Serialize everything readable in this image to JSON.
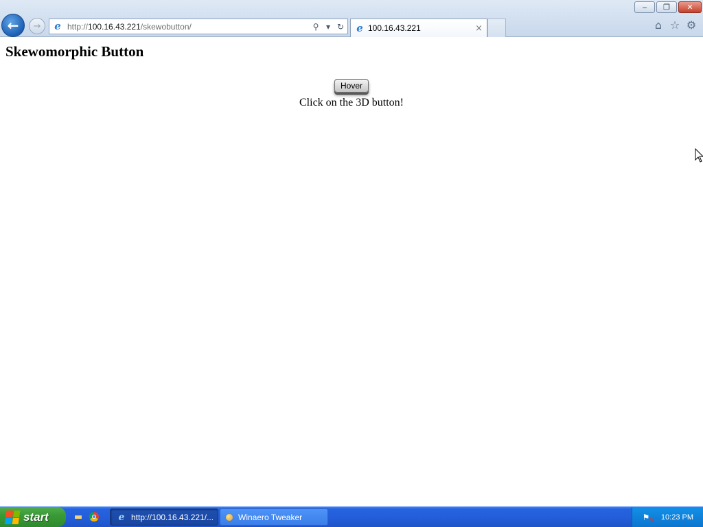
{
  "window": {
    "minimize_label": "‒",
    "restore_label": "❐",
    "close_label": "✕"
  },
  "navigation": {
    "back_label": "←",
    "forward_label": "→"
  },
  "address_bar": {
    "url_scheme": "http://",
    "url_host": "100.16.43.221",
    "url_path": "/skewobutton/",
    "search_glyph": "⚲",
    "dropdown_glyph": "▾",
    "refresh_glyph": "↻"
  },
  "tabs": [
    {
      "title": "100.16.43.221",
      "close_glyph": "×"
    }
  ],
  "toolbar": {
    "home_glyph": "⌂",
    "favorites_glyph": "☆",
    "tools_glyph": "⚙"
  },
  "page": {
    "title": "Skewomorphic Button",
    "button_label": "Hover",
    "instruction": "Click on the 3D button!"
  },
  "taskbar": {
    "start_label": "start",
    "tasks": [
      {
        "label": "http://100.16.43.221/...",
        "icon": "ie-icon",
        "active": true
      },
      {
        "label": "Winaero Tweaker",
        "icon": "tweaker-icon",
        "active": false
      }
    ],
    "clock": "10:23 PM"
  },
  "colors": {
    "taskbar_blue": "#245edb",
    "start_green": "#3a9a37",
    "tray_blue": "#0f82db"
  }
}
